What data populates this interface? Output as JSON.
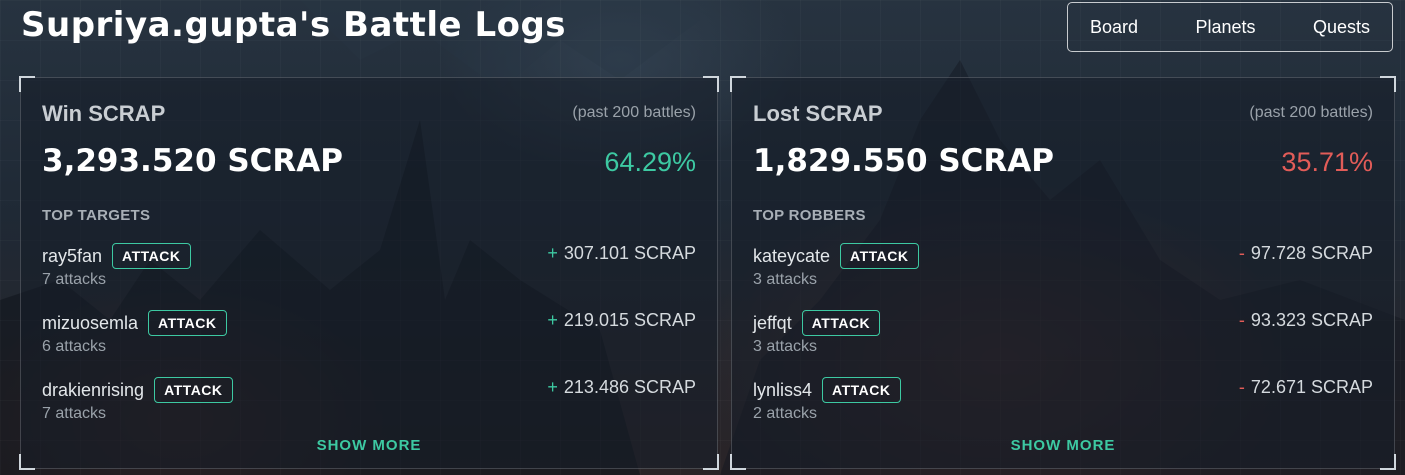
{
  "header": {
    "title": "Supriya.gupta's Battle Logs"
  },
  "nav": {
    "items": [
      {
        "label": "Board"
      },
      {
        "label": "Planets"
      },
      {
        "label": "Quests"
      }
    ]
  },
  "win_panel": {
    "heading": "Win SCRAP",
    "period": "(past 200 battles)",
    "amount": "3,293.520 SCRAP",
    "percent": "64.29%",
    "section_label": "TOP TARGETS",
    "entries": [
      {
        "name": "ray5fan",
        "action": "ATTACK",
        "attacks": "7 attacks",
        "sign": "+",
        "value": "307.101 SCRAP"
      },
      {
        "name": "mizuosemla",
        "action": "ATTACK",
        "attacks": "6 attacks",
        "sign": "+",
        "value": "219.015 SCRAP"
      },
      {
        "name": "drakienrising",
        "action": "ATTACK",
        "attacks": "7 attacks",
        "sign": "+",
        "value": "213.486 SCRAP"
      }
    ],
    "show_more": "SHOW MORE"
  },
  "loss_panel": {
    "heading": "Lost SCRAP",
    "period": "(past 200 battles)",
    "amount": "1,829.550 SCRAP",
    "percent": "35.71%",
    "section_label": "TOP ROBBERS",
    "entries": [
      {
        "name": "kateycate",
        "action": "ATTACK",
        "attacks": "3 attacks",
        "sign": "-",
        "value": "97.728 SCRAP"
      },
      {
        "name": "jeffqt",
        "action": "ATTACK",
        "attacks": "3 attacks",
        "sign": "-",
        "value": "93.323 SCRAP"
      },
      {
        "name": "lynliss4",
        "action": "ATTACK",
        "attacks": "2 attacks",
        "sign": "-",
        "value": "72.671 SCRAP"
      }
    ],
    "show_more": "SHOW MORE"
  },
  "colors": {
    "win_accent": "#3dc9a2",
    "loss_accent": "#e25c58"
  }
}
